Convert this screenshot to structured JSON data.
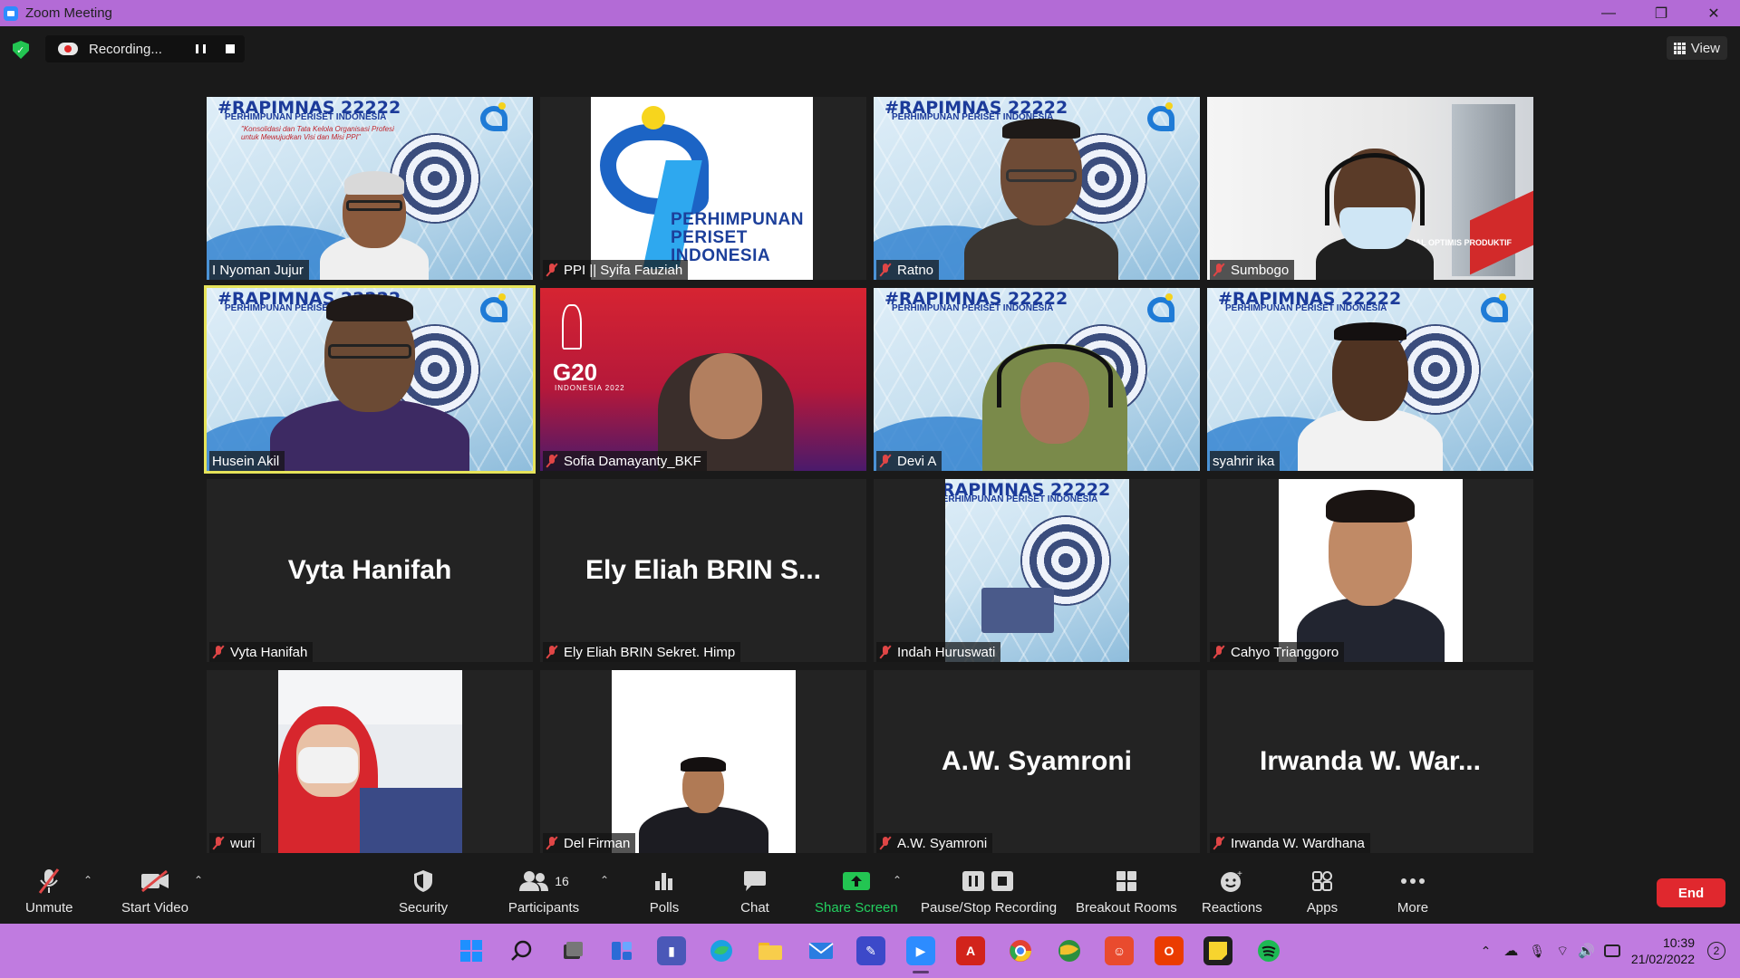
{
  "window": {
    "title": "Zoom Meeting",
    "controls": [
      "—",
      "❐",
      "✕"
    ]
  },
  "topbar": {
    "recording_label": "Recording...",
    "view_label": "View"
  },
  "tiles": [
    {
      "name": "I Nyoman Jujur",
      "muted": false,
      "type": "rapim"
    },
    {
      "name": "PPI || Syifa Fauziah",
      "muted": true,
      "type": "ppi"
    },
    {
      "name": "Ratno",
      "muted": true,
      "type": "rapim"
    },
    {
      "name": "Sumbogo",
      "muted": true,
      "type": "office"
    },
    {
      "name": "Husein Akil",
      "muted": false,
      "type": "rapim",
      "active": true
    },
    {
      "name": "Sofia Damayanty_BKF",
      "muted": true,
      "type": "g20"
    },
    {
      "name": "Devi A",
      "muted": true,
      "type": "rapim"
    },
    {
      "name": "syahrir ika",
      "muted": false,
      "type": "rapim"
    },
    {
      "name": "Vyta Hanifah",
      "muted": true,
      "type": "text",
      "center": "Vyta Hanifah"
    },
    {
      "name": "Ely Eliah BRIN Sekret. Himp",
      "muted": true,
      "type": "text",
      "center": "Ely Eliah BRIN S..."
    },
    {
      "name": "Indah Huruswati",
      "muted": true,
      "type": "rapim-small"
    },
    {
      "name": "Cahyo Trianggoro",
      "muted": true,
      "type": "portrait"
    },
    {
      "name": "wuri",
      "muted": true,
      "type": "portrait"
    },
    {
      "name": "Del Firman",
      "muted": true,
      "type": "portrait"
    },
    {
      "name": "A.W. Syamroni",
      "muted": true,
      "type": "text",
      "center": "A.W. Syamroni"
    },
    {
      "name": "Irwanda W. Wardhana",
      "muted": true,
      "type": "text",
      "center": "Irwanda W. War..."
    }
  ],
  "backgrounds": {
    "rapim_title": "#RAPIMNAS 22222",
    "rapim_sub": "PERHIMPUNAN PERISET INDONESIA",
    "rapim_tagline": "\"Konsolidasi dan Tata Kelola Organisasi Profesi untuk Mewujudkan Visi dan Misi PPI\"",
    "ppi_logo_text": "PERHIMPUNAN PERISET INDONESIA",
    "g20_title": "G20",
    "g20_sub": "INDONESIA 2022",
    "office_text": "PROFESIONAL OPTIMIS PRODUKTIF"
  },
  "toolbar": {
    "unmute": "Unmute",
    "start_video": "Start Video",
    "security": "Security",
    "participants": "Participants",
    "participants_count": "16",
    "polls": "Polls",
    "chat": "Chat",
    "share_screen": "Share Screen",
    "pause_stop_recording": "Pause/Stop Recording",
    "breakout_rooms": "Breakout Rooms",
    "reactions": "Reactions",
    "apps": "Apps",
    "more": "More",
    "end": "End"
  },
  "taskbar": {
    "time": "10:39",
    "date": "21/02/2022",
    "notifications": "2"
  },
  "colors": {
    "titlebar": "#b36bd6",
    "taskbar": "#c07be0",
    "end_button": "#e0282e",
    "share_green": "#23d160",
    "active_speaker": "#e6e35a"
  }
}
